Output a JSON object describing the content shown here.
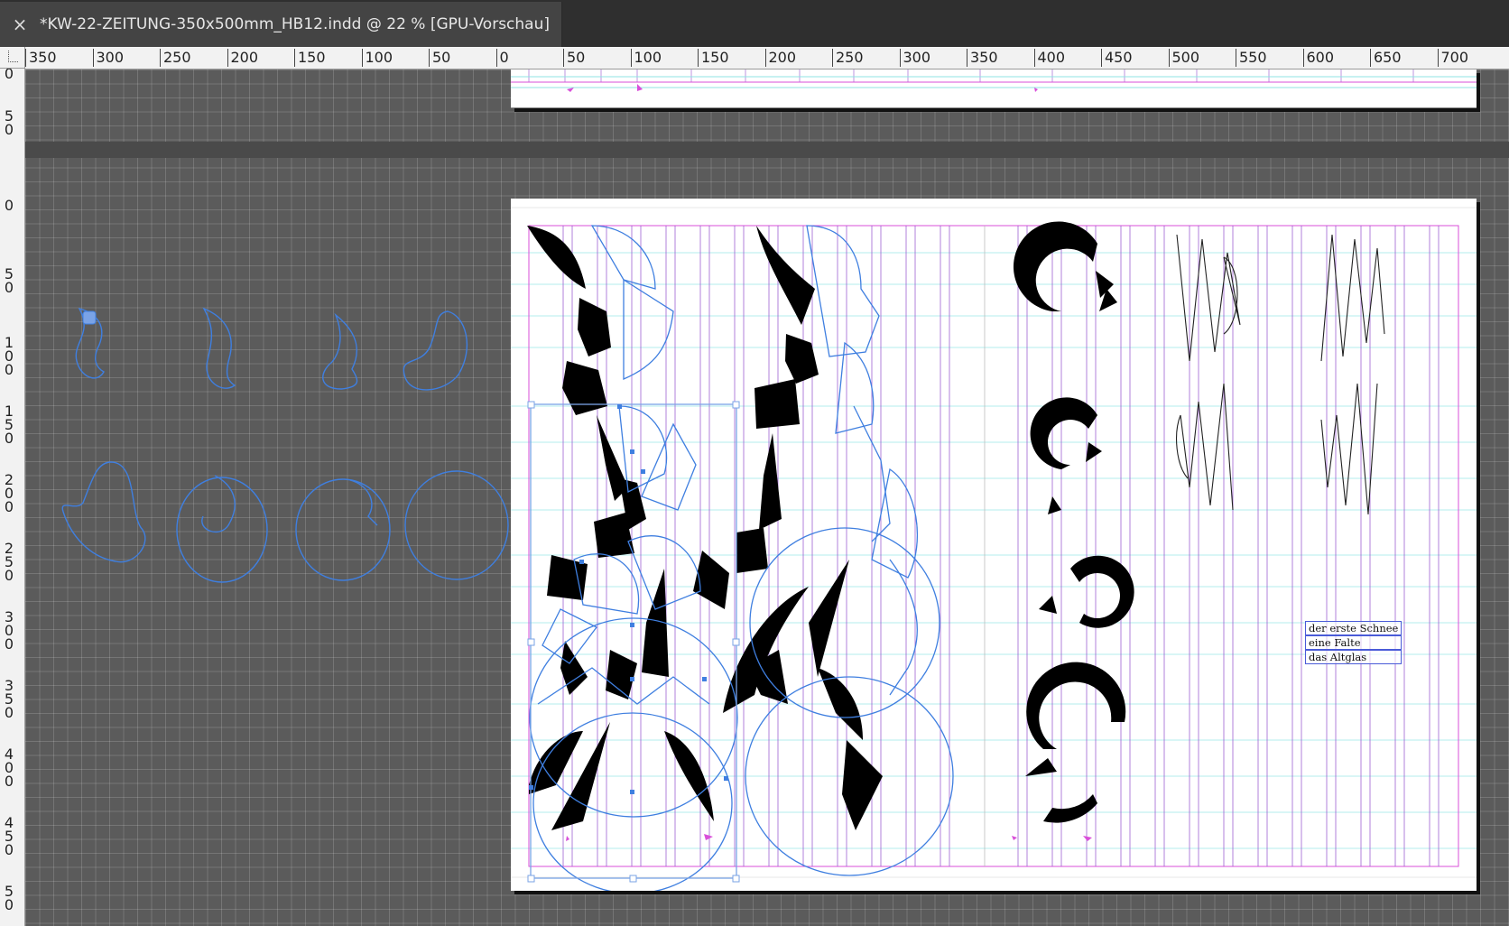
{
  "window": {
    "tab_title": "*KW-22-ZEITUNG-350x500mm_HB12.indd @ 22 % [GPU-Vorschau]",
    "close_glyph": "×"
  },
  "ruler": {
    "horizontal": [
      "350",
      "300",
      "250",
      "200",
      "150",
      "100",
      "50",
      "0",
      "50",
      "100",
      "150",
      "200",
      "250",
      "300",
      "350",
      "400",
      "450",
      "500",
      "550",
      "600",
      "650",
      "700"
    ],
    "vertical_top": [
      "0",
      "5\n0"
    ],
    "vertical": [
      "0",
      "5\n0",
      "1\n0\n0",
      "1\n5\n0",
      "2\n0\n0",
      "2\n5\n0",
      "3\n0\n0",
      "3\n5\n0",
      "4\n0\n0",
      "4\n5\n0",
      "5\n0"
    ]
  },
  "canvas": {
    "text_lines": [
      "der erste Schnee",
      "eine Falte",
      "das Altglas"
    ]
  },
  "colors": {
    "guide_purple": "#9a5bd0",
    "guide_cyan": "#8fe3e3",
    "path_blue": "#3f7fe0",
    "fill_black": "#000000",
    "margin_magenta": "#d94fd9"
  },
  "icons": [
    "close-icon",
    "ruler-origin-icon",
    "anchor-icon"
  ]
}
